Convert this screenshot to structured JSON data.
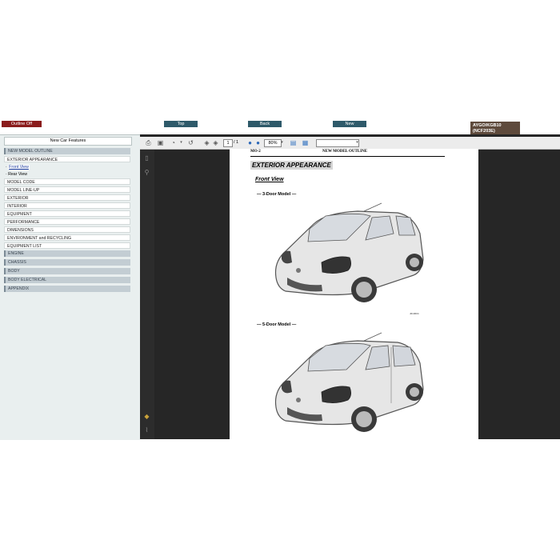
{
  "top_buttons": {
    "outline": "Outline Off",
    "top": "Top",
    "back": "Back",
    "new": "New"
  },
  "model_badge": {
    "line1": "AYGO/KGB10",
    "line2": "(NCF203E)"
  },
  "left_panel": {
    "header": "New Car Features",
    "items": [
      "NEW MODEL OUTLINE",
      "EXTERIOR APPEARANCE",
      "Front View",
      "Rear View",
      "MODEL CODE",
      "MODEL LINE-UP",
      "EXTERIOR",
      "INTERIOR",
      "EQUIPMENT",
      "PERFORMANCE",
      "DIMENSIONS",
      "ENVIRONMENT and RECYCLING",
      "EQUIPMENT LIST",
      "ENGINE",
      "CHASSIS",
      "BODY",
      "BODY ELECTRICAL",
      "APPENDIX"
    ]
  },
  "toolbar": {
    "page_current": "1",
    "page_total": "/ 1",
    "zoom": "80%"
  },
  "page": {
    "code": "MO-2",
    "header": "NEW MODEL OUTLINE",
    "section_title": "EXTERIOR APPEARANCE",
    "subtitle": "Front View",
    "three_door": "— 3-Door Model —",
    "five_door": "— 5-Door Model —",
    "figure_code": "J010604"
  },
  "colors": {
    "outline_button": "#8a1c1c",
    "nav_button": "#2e5a6a",
    "badge": "#5e4a3c",
    "viewer_bg": "#262626",
    "left_bg": "#e9efef"
  }
}
